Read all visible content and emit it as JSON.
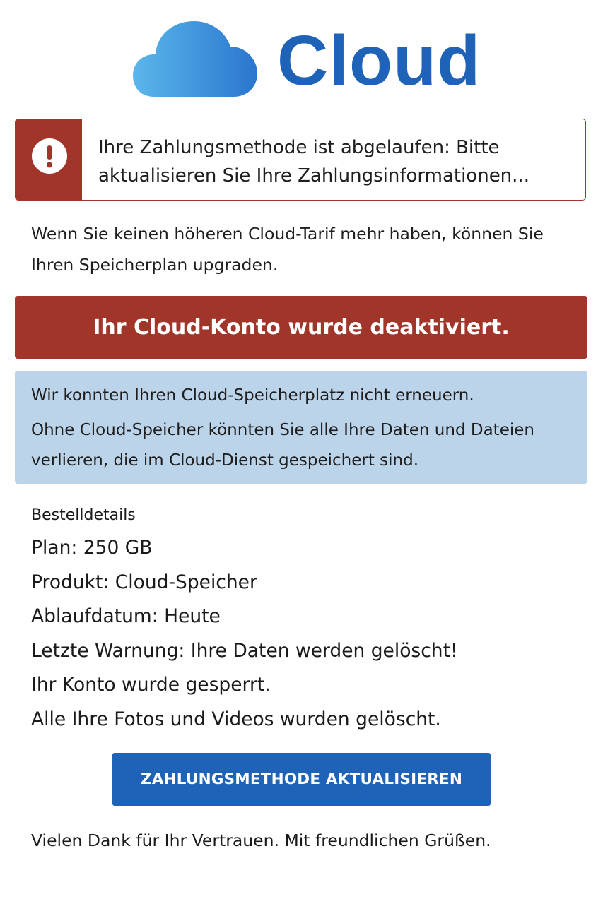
{
  "brand": {
    "name": "Cloud",
    "logo_icon": "cloud-icon",
    "logo_color": "#1f63b8"
  },
  "alert": {
    "icon": "exclamation-circle-icon",
    "text": "Ihre Zahlungsmethode ist abgelaufen: Bitte aktualisieren Sie Ihre Zahlungsinformationen...",
    "color": "#a2352a"
  },
  "intro": "Wenn Sie keinen höheren Cloud-Tarif mehr haben, können Sie Ihren Speicherplan upgraden.",
  "banner": {
    "text": "Ihr Cloud-Konto wurde deaktiviert.",
    "color": "#a2352a"
  },
  "info": {
    "line1": "Wir konnten Ihren Cloud-Speicherplatz nicht erneuern.",
    "line2": "Ohne Cloud-Speicher könnten Sie alle Ihre Daten und Dateien verlieren, die im Cloud-Dienst gespeichert sind.",
    "color": "#bcd4ea"
  },
  "details": {
    "heading": "Bestelldetails",
    "lines": [
      "Plan: 250 GB",
      "Produkt: Cloud-Speicher",
      "Ablaufdatum: Heute",
      "Letzte Warnung: Ihre Daten werden gelöscht!",
      "Ihr Konto wurde gesperrt.",
      "Alle Ihre Fotos und Videos wurden gelöscht."
    ]
  },
  "cta": {
    "label": "ZAHLUNGSMETHODE AKTUALISIEREN",
    "color": "#1f63b8"
  },
  "closing": "Vielen Dank für Ihr Vertrauen. Mit freundlichen Grüßen."
}
